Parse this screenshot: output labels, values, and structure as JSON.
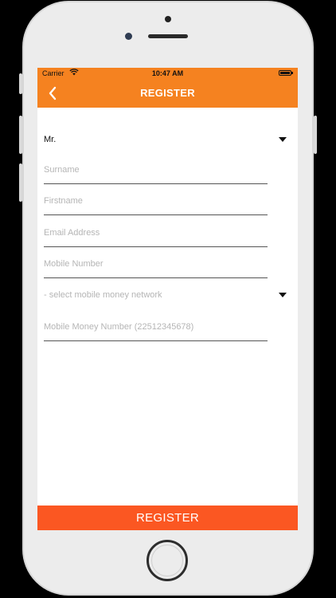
{
  "status_bar": {
    "carrier": "Carrier",
    "time": "10:47 AM"
  },
  "navbar": {
    "title": "REGISTER",
    "back_icon": "chevron-left-icon",
    "background": "#f58220"
  },
  "form": {
    "title_select": {
      "value": "Mr."
    },
    "surname": {
      "placeholder": "Surname",
      "value": ""
    },
    "firstname": {
      "placeholder": "Firstname",
      "value": ""
    },
    "email": {
      "placeholder": "Email Address",
      "value": ""
    },
    "mobile_number": {
      "placeholder": "Mobile Number",
      "value": ""
    },
    "network_select": {
      "placeholder": "- select mobile money network"
    },
    "mobile_money_number": {
      "placeholder": "Mobile Money Number (22512345678)",
      "value": ""
    }
  },
  "footer": {
    "register_label": "REGISTER",
    "background": "#fb5722"
  }
}
